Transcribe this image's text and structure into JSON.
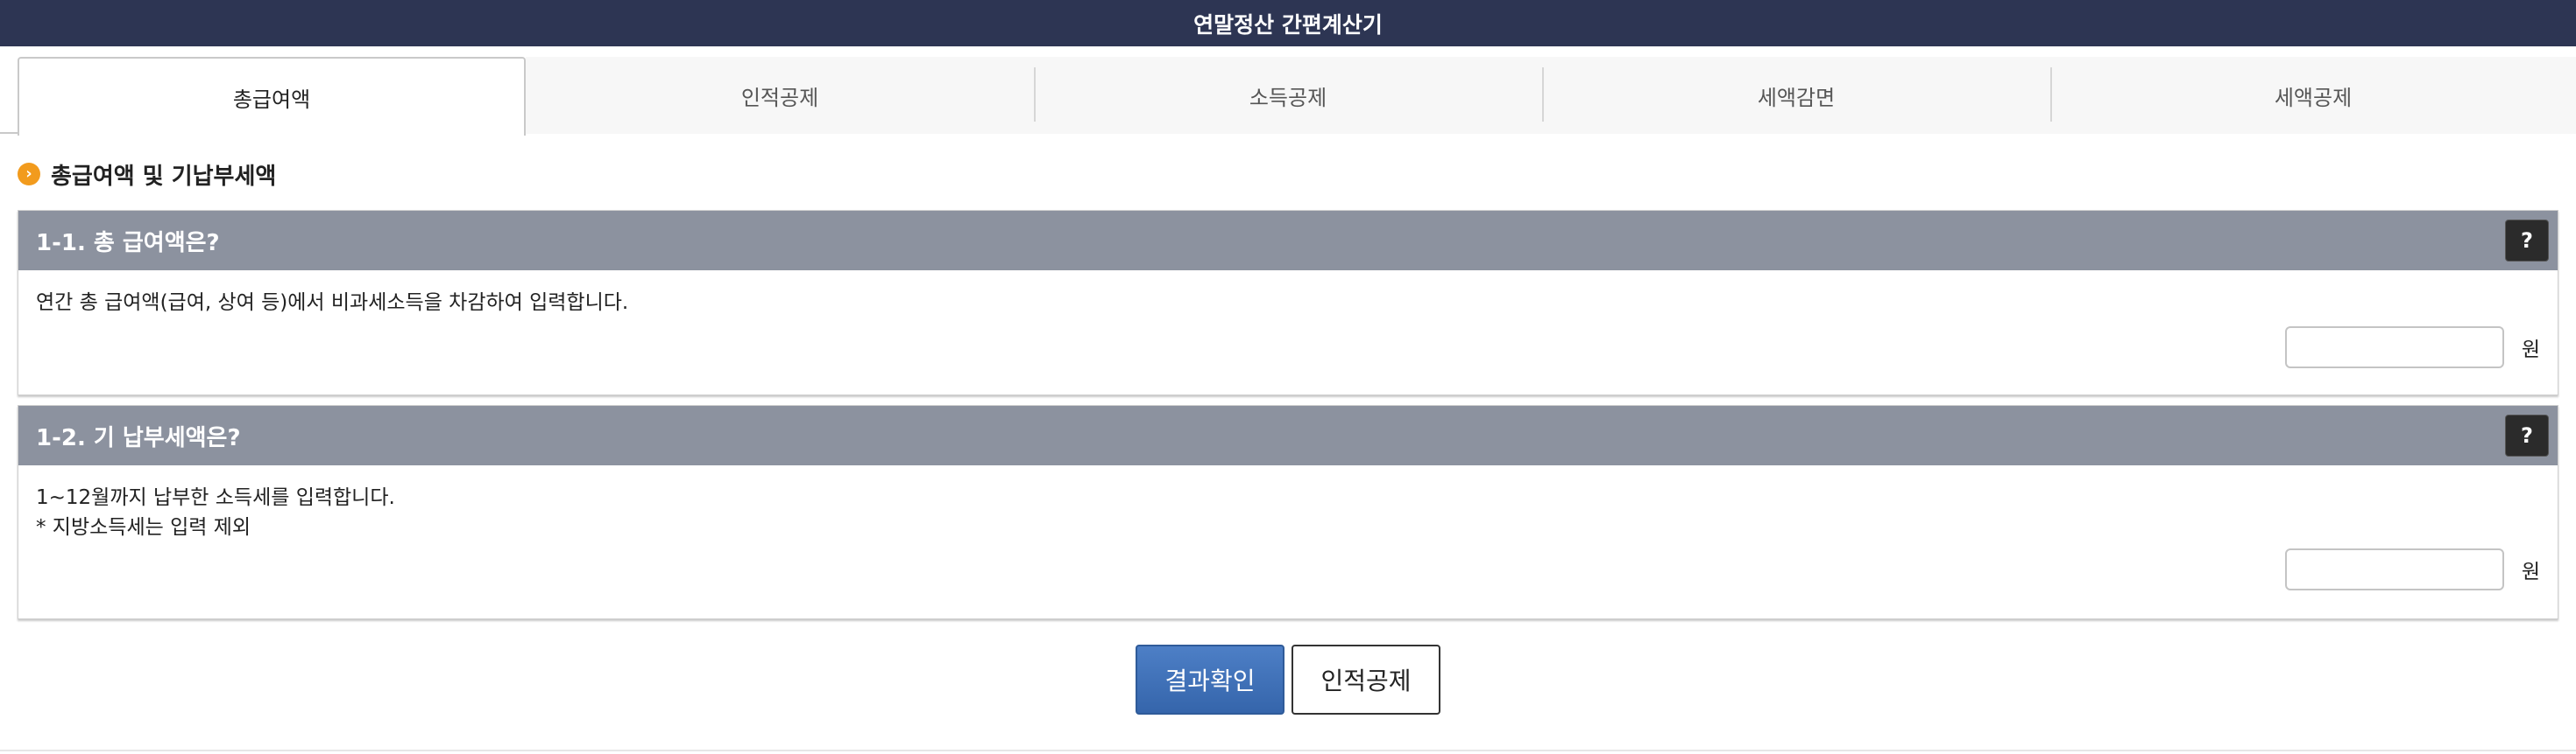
{
  "app": {
    "title": "연말정산 간편계산기"
  },
  "tabs": [
    {
      "label": "총급여액",
      "active": true
    },
    {
      "label": "인적공제",
      "active": false
    },
    {
      "label": "소득공제",
      "active": false
    },
    {
      "label": "세액감면",
      "active": false
    },
    {
      "label": "세액공제",
      "active": false
    }
  ],
  "section": {
    "title": "총급여액 및 기납부세액",
    "icon": "chevron-right-circle-icon"
  },
  "questions": [
    {
      "title": "1-1. 총 급여액은?",
      "help_label": "?",
      "description": [
        "연간 총 급여액(급여, 상여 등)에서 비과세소득을 차감하여 입력합니다."
      ],
      "input_value": "",
      "unit": "원"
    },
    {
      "title": "1-2. 기 납부세액은?",
      "help_label": "?",
      "description": [
        "1~12월까지 납부한 소득세를 입력합니다.",
        "* 지방소득세는 입력 제외"
      ],
      "input_value": "",
      "unit": "원"
    }
  ],
  "buttons": {
    "result": "결과확인",
    "next": "인적공제"
  },
  "colors": {
    "header": "#2d3553",
    "question_header": "#8c929f",
    "primary_button": "#3f6fb5",
    "section_icon": "#f29b1d"
  }
}
